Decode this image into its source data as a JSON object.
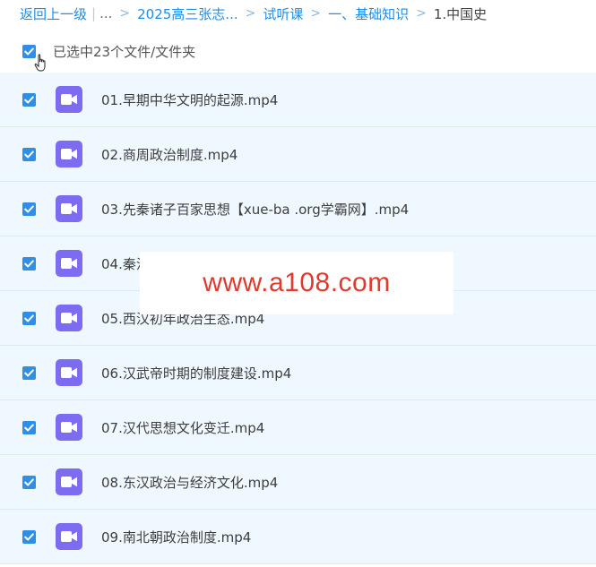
{
  "breadcrumb": {
    "back_label": "返回上一级",
    "ellipsis": "...",
    "items": [
      "2025高三张志...",
      "试听课",
      "一、基础知识"
    ],
    "current": "1.中国史"
  },
  "selection": {
    "label": "已选中23个文件/文件夹",
    "checked": true
  },
  "files": [
    {
      "name": "01.早期中华文明的起源.mp4",
      "checked": true
    },
    {
      "name": "02.商周政治制度.mp4",
      "checked": true
    },
    {
      "name": "03.先秦诸子百家思想【xue-ba .org学霸网】.mp4",
      "checked": true
    },
    {
      "name": "04.秦汉",
      "checked": true
    },
    {
      "name": "05.西汉初年政治生态.mp4",
      "checked": true
    },
    {
      "name": "06.汉武帝时期的制度建设.mp4",
      "checked": true
    },
    {
      "name": "07.汉代思想文化变迁.mp4",
      "checked": true
    },
    {
      "name": "08.东汉政治与经济文化.mp4",
      "checked": true
    },
    {
      "name": "09.南北朝政治制度.mp4",
      "checked": true
    }
  ],
  "file_icon": "video-file-icon",
  "watermark": "www.a108.com",
  "colors": {
    "link": "#1f8ce6",
    "checkbox": "#2f8ee5",
    "row_bg": "#f0f8ff",
    "file_icon": "#7d6cf2",
    "watermark": "#e03a2f"
  }
}
